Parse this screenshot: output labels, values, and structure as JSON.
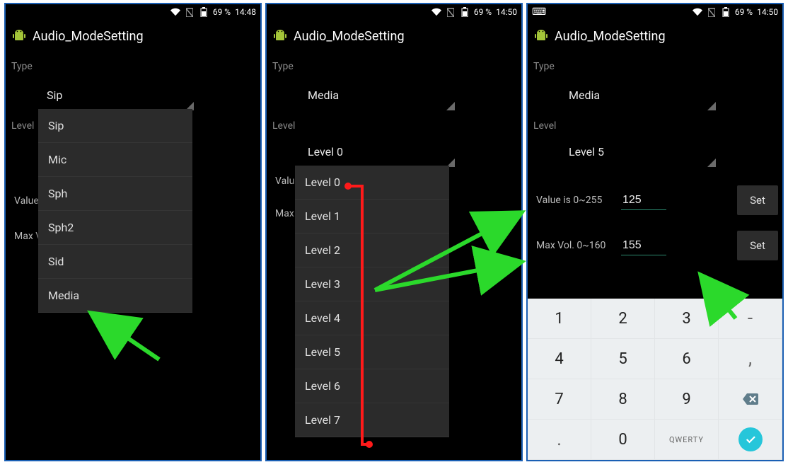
{
  "app_title": "Audio_ModeSetting",
  "labels": {
    "type": "Type",
    "level": "Level",
    "value_is": "Value is 0~255",
    "max_vol": "Max Vol. 0~160",
    "set": "Set",
    "value_short": "Value",
    "max_short": "Max V"
  },
  "screen1": {
    "status": {
      "battery": "69 %",
      "time": "14:48"
    },
    "type_selected": "Sip",
    "dropdown": [
      "Sip",
      "Mic",
      "Sph",
      "Sph2",
      "Sid",
      "Media"
    ]
  },
  "screen2": {
    "status": {
      "battery": "69 %",
      "time": "14:50"
    },
    "type_selected": "Media",
    "level_selected": "Level 0",
    "dropdown": [
      "Level 0",
      "Level 1",
      "Level 2",
      "Level 3",
      "Level 4",
      "Level 5",
      "Level 6",
      "Level 7"
    ]
  },
  "screen3": {
    "status": {
      "battery": "69 %",
      "time": "14:50"
    },
    "type_selected": "Media",
    "level_selected": "Level 5",
    "value": "125",
    "max_vol": "155",
    "keypad": {
      "rows": [
        [
          "1",
          "2",
          "3",
          "-"
        ],
        [
          "4",
          "5",
          "6",
          ","
        ],
        [
          "7",
          "8",
          "9",
          "⌫"
        ],
        [
          ".",
          "0",
          "QWERTY",
          "✓"
        ]
      ]
    }
  }
}
